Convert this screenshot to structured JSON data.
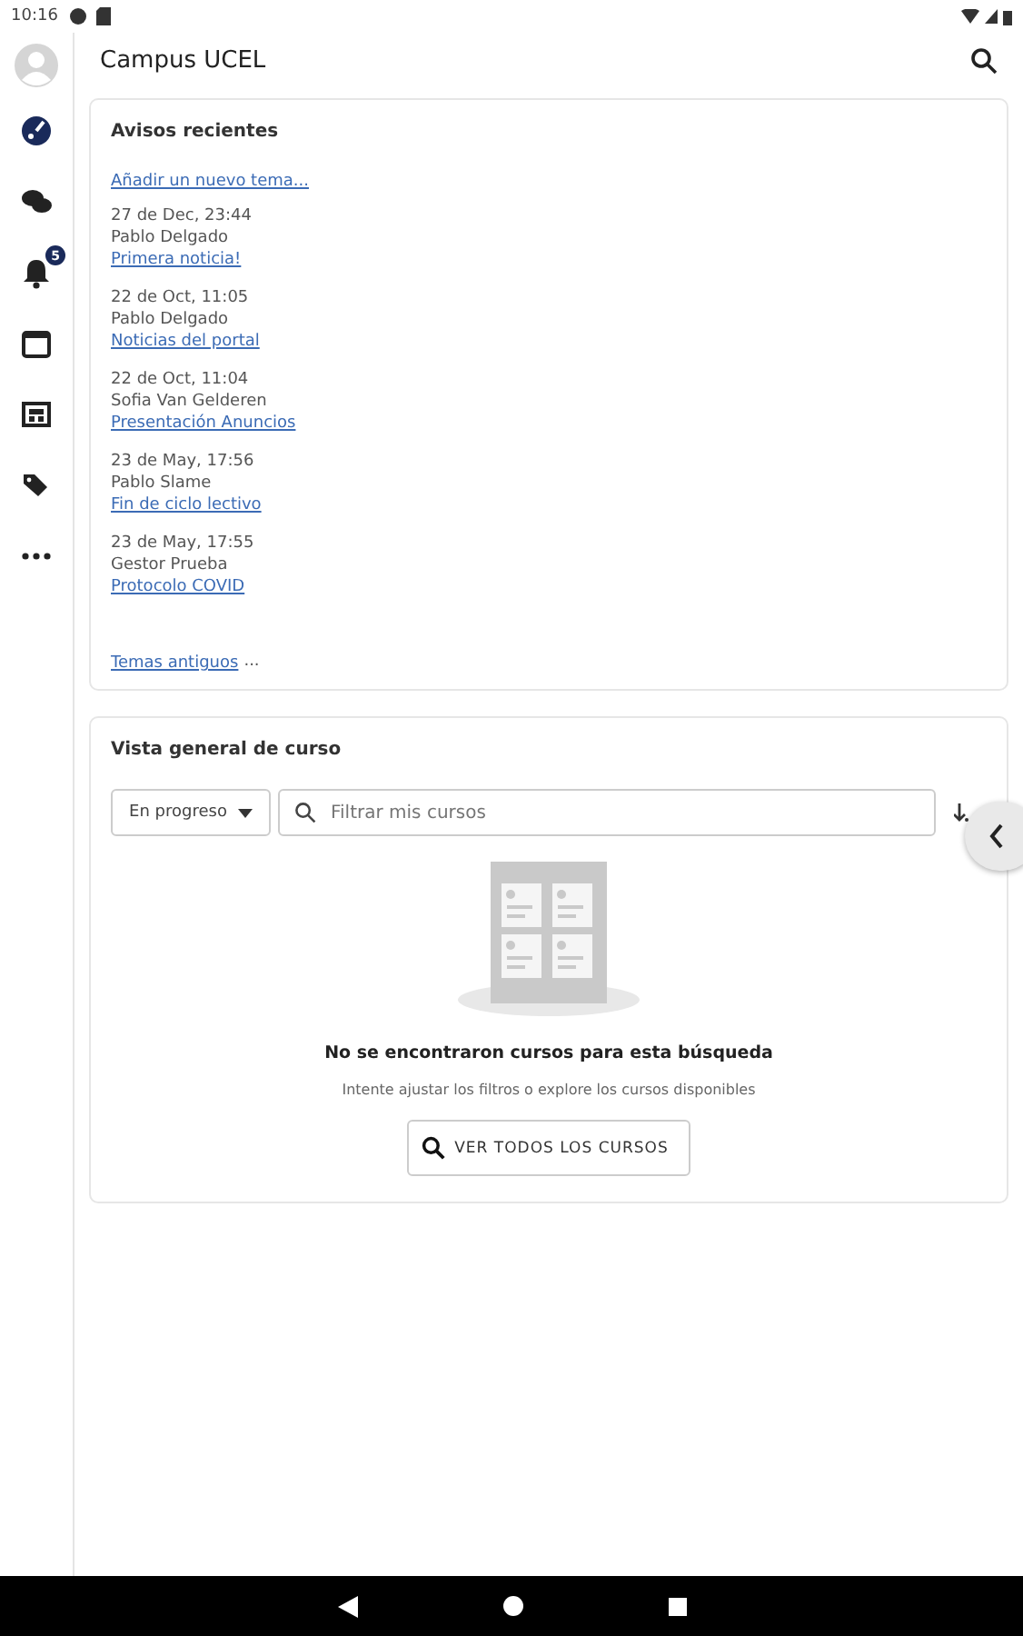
{
  "status_bar": {
    "time": "10:16"
  },
  "header": {
    "title": "Campus UCEL"
  },
  "sidebar": {
    "items": [
      {
        "kind": "dashboard"
      },
      {
        "kind": "messages"
      },
      {
        "kind": "notifications",
        "badge": "5"
      },
      {
        "kind": "calendar"
      },
      {
        "kind": "news"
      },
      {
        "kind": "tags"
      },
      {
        "kind": "more"
      }
    ]
  },
  "announcements": {
    "title": "Avisos recientes",
    "add_link": "Añadir un nuevo tema...",
    "posts": [
      {
        "date": "27 de Dec, 23:44",
        "author": "Pablo Delgado",
        "topic": "Primera noticia!"
      },
      {
        "date": "22 de Oct, 11:05",
        "author": "Pablo Delgado",
        "topic": "Noticias del portal"
      },
      {
        "date": "22 de Oct, 11:04",
        "author": "Sofia Van Gelderen",
        "topic": "Presentación Anuncios"
      },
      {
        "date": "23 de May, 17:56",
        "author": "Pablo Slame",
        "topic": "Fin de ciclo lectivo"
      },
      {
        "date": "23 de May, 17:55",
        "author": "Gestor Prueba",
        "topic": "Protocolo COVID"
      }
    ],
    "older_link": "Temas antiguos",
    "older_suffix": "..."
  },
  "course_overview": {
    "title": "Vista general de curso",
    "filter": "En progreso",
    "search": {
      "placeholder": "Filtrar mis cursos"
    },
    "empty_title": "No se encontraron cursos para esta búsqueda",
    "empty_hint": "Intente ajustar los filtros o explore los cursos disponibles",
    "button": "VER TODOS LOS CURSOS"
  }
}
